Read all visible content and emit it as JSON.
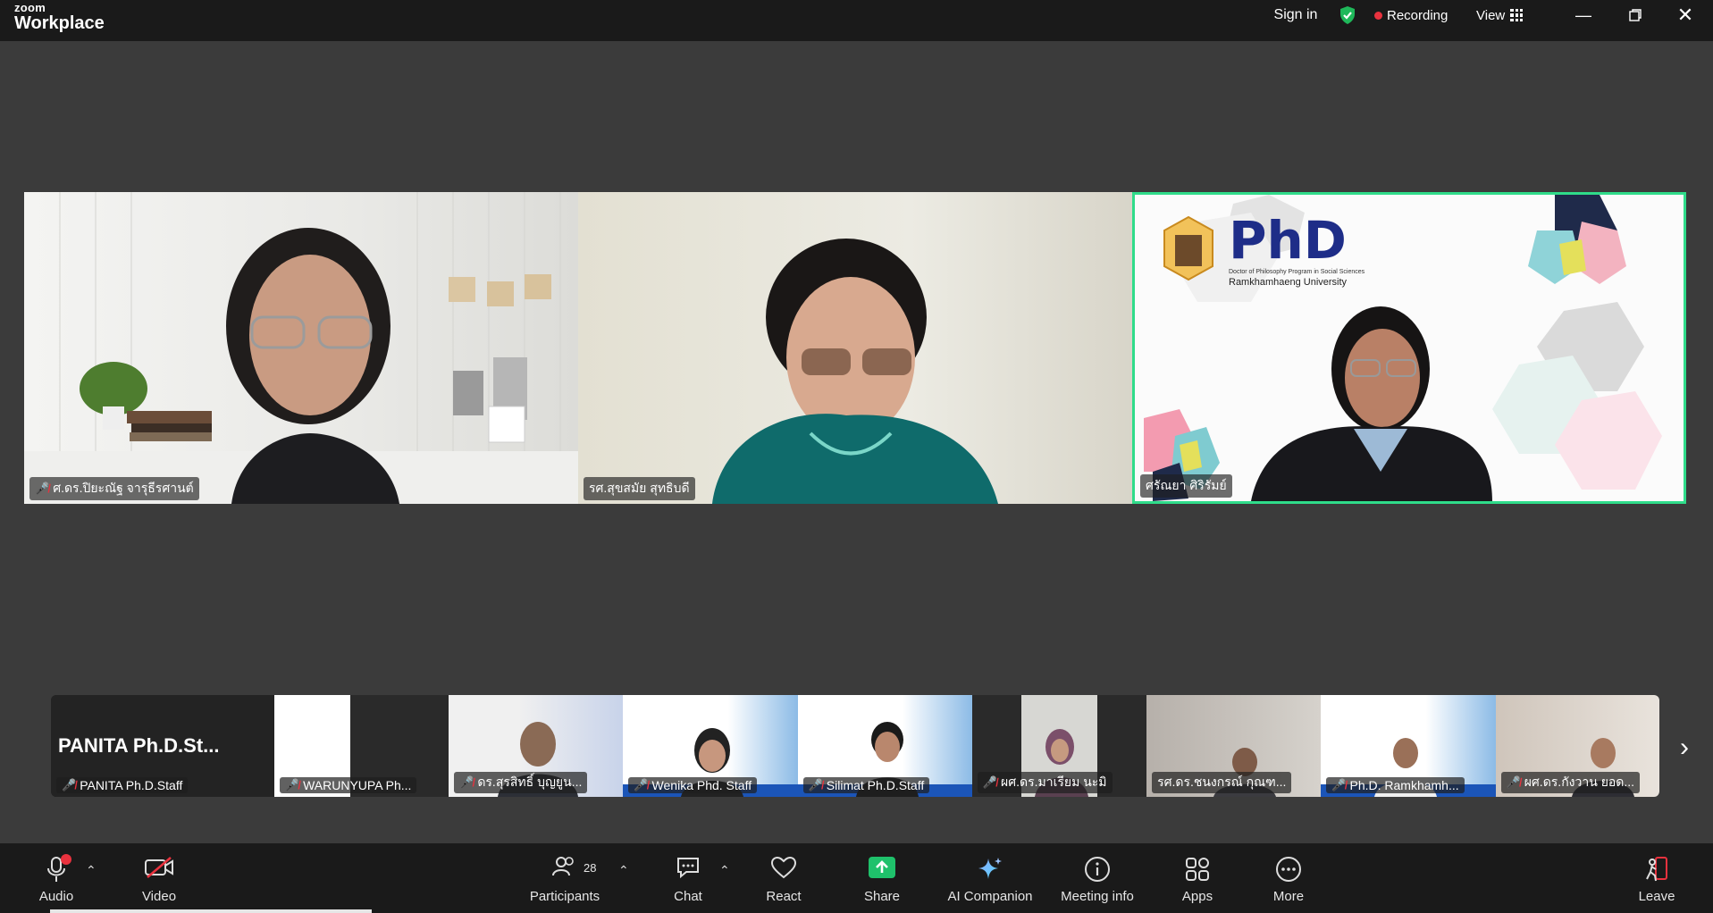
{
  "app": {
    "brand_small": "zoom",
    "brand_large": "Workplace"
  },
  "titlebar": {
    "sign_in": "Sign in",
    "recording": "Recording",
    "view": "View",
    "icons": [
      "shield-icon",
      "minimize-icon",
      "restore-icon",
      "close-icon"
    ]
  },
  "main_tiles": [
    {
      "name": "ศ.ดร.ปิยะณัฐ จารุธีรศานต์",
      "muted": true
    },
    {
      "name": "รศ.สุขสมัย สุทธิบดี",
      "muted": false
    },
    {
      "name": "ศรัณยา ศิริรัมย์",
      "muted": false,
      "active_speaker": true
    }
  ],
  "slide": {
    "logo_text": "PhD",
    "subtitle": "Doctor of Philosophy Program in Social Sciences",
    "university": "Ramkhamhaeng University"
  },
  "strip": {
    "big_name": "PANITA Ph.D.St...",
    "tiles": [
      {
        "name": "PANITA Ph.D.Staff",
        "muted": true
      },
      {
        "name": "WARUNYUPA Ph...",
        "muted": true
      },
      {
        "name": "ดร.สุรสิทธิ์ บุญยูน...",
        "muted": true
      },
      {
        "name": "Wenika Phd. Staff",
        "muted": true
      },
      {
        "name": "Silimat Ph.D.Staff",
        "muted": true
      },
      {
        "name": "ผศ.ดร.มาเรียม นะมิ",
        "muted": true
      },
      {
        "name": "รศ.ดร.ชนงกรณ์ กุณฑ...",
        "muted": false
      },
      {
        "name": "Ph.D. Ramkhamh...",
        "muted": true
      },
      {
        "name": "ผศ.ดร.กังวาน ยอด...",
        "muted": true
      }
    ]
  },
  "toolbar": {
    "audio": "Audio",
    "video": "Video",
    "participants": "Participants",
    "participant_count": "28",
    "chat": "Chat",
    "react": "React",
    "share": "Share",
    "ai_companion": "AI Companion",
    "meeting_info": "Meeting info",
    "apps": "Apps",
    "more": "More",
    "leave": "Leave"
  },
  "colors": {
    "accent_green": "#2fdc8a",
    "record_red": "#e9323e",
    "share_green": "#1fc16b"
  }
}
